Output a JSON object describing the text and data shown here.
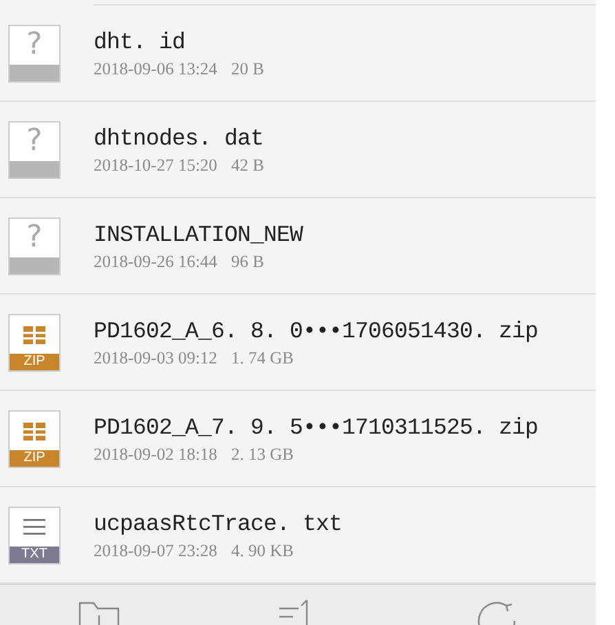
{
  "files": [
    {
      "kind": "unknown",
      "name": "dht. id",
      "date": "2018-09-06 13:24",
      "size": "20 B",
      "glyph": "?"
    },
    {
      "kind": "unknown",
      "name": "dhtnodes. dat",
      "date": "2018-10-27 15:20",
      "size": "42 B",
      "glyph": "?"
    },
    {
      "kind": "unknown",
      "name": "INSTALLATION_NEW",
      "date": "2018-09-26 16:44",
      "size": "96 B",
      "glyph": "?"
    },
    {
      "kind": "zip",
      "name": "PD1602_A_6. 8. 0•••1706051430. zip",
      "date": "2018-09-03 09:12",
      "size": "1. 74 GB",
      "badge": "ZIP"
    },
    {
      "kind": "zip",
      "name": "PD1602_A_7. 9. 5•••1710311525. zip",
      "date": "2018-09-02 18:18",
      "size": "2. 13 GB",
      "badge": "ZIP"
    },
    {
      "kind": "txt",
      "name": "ucpaasRtcTrace. txt",
      "date": "2018-09-07 23:28",
      "size": "4. 90 KB",
      "badge": "TXT"
    }
  ],
  "toolbar": [
    {
      "kind": "folder"
    },
    {
      "kind": "sort"
    },
    {
      "kind": "refresh"
    }
  ]
}
